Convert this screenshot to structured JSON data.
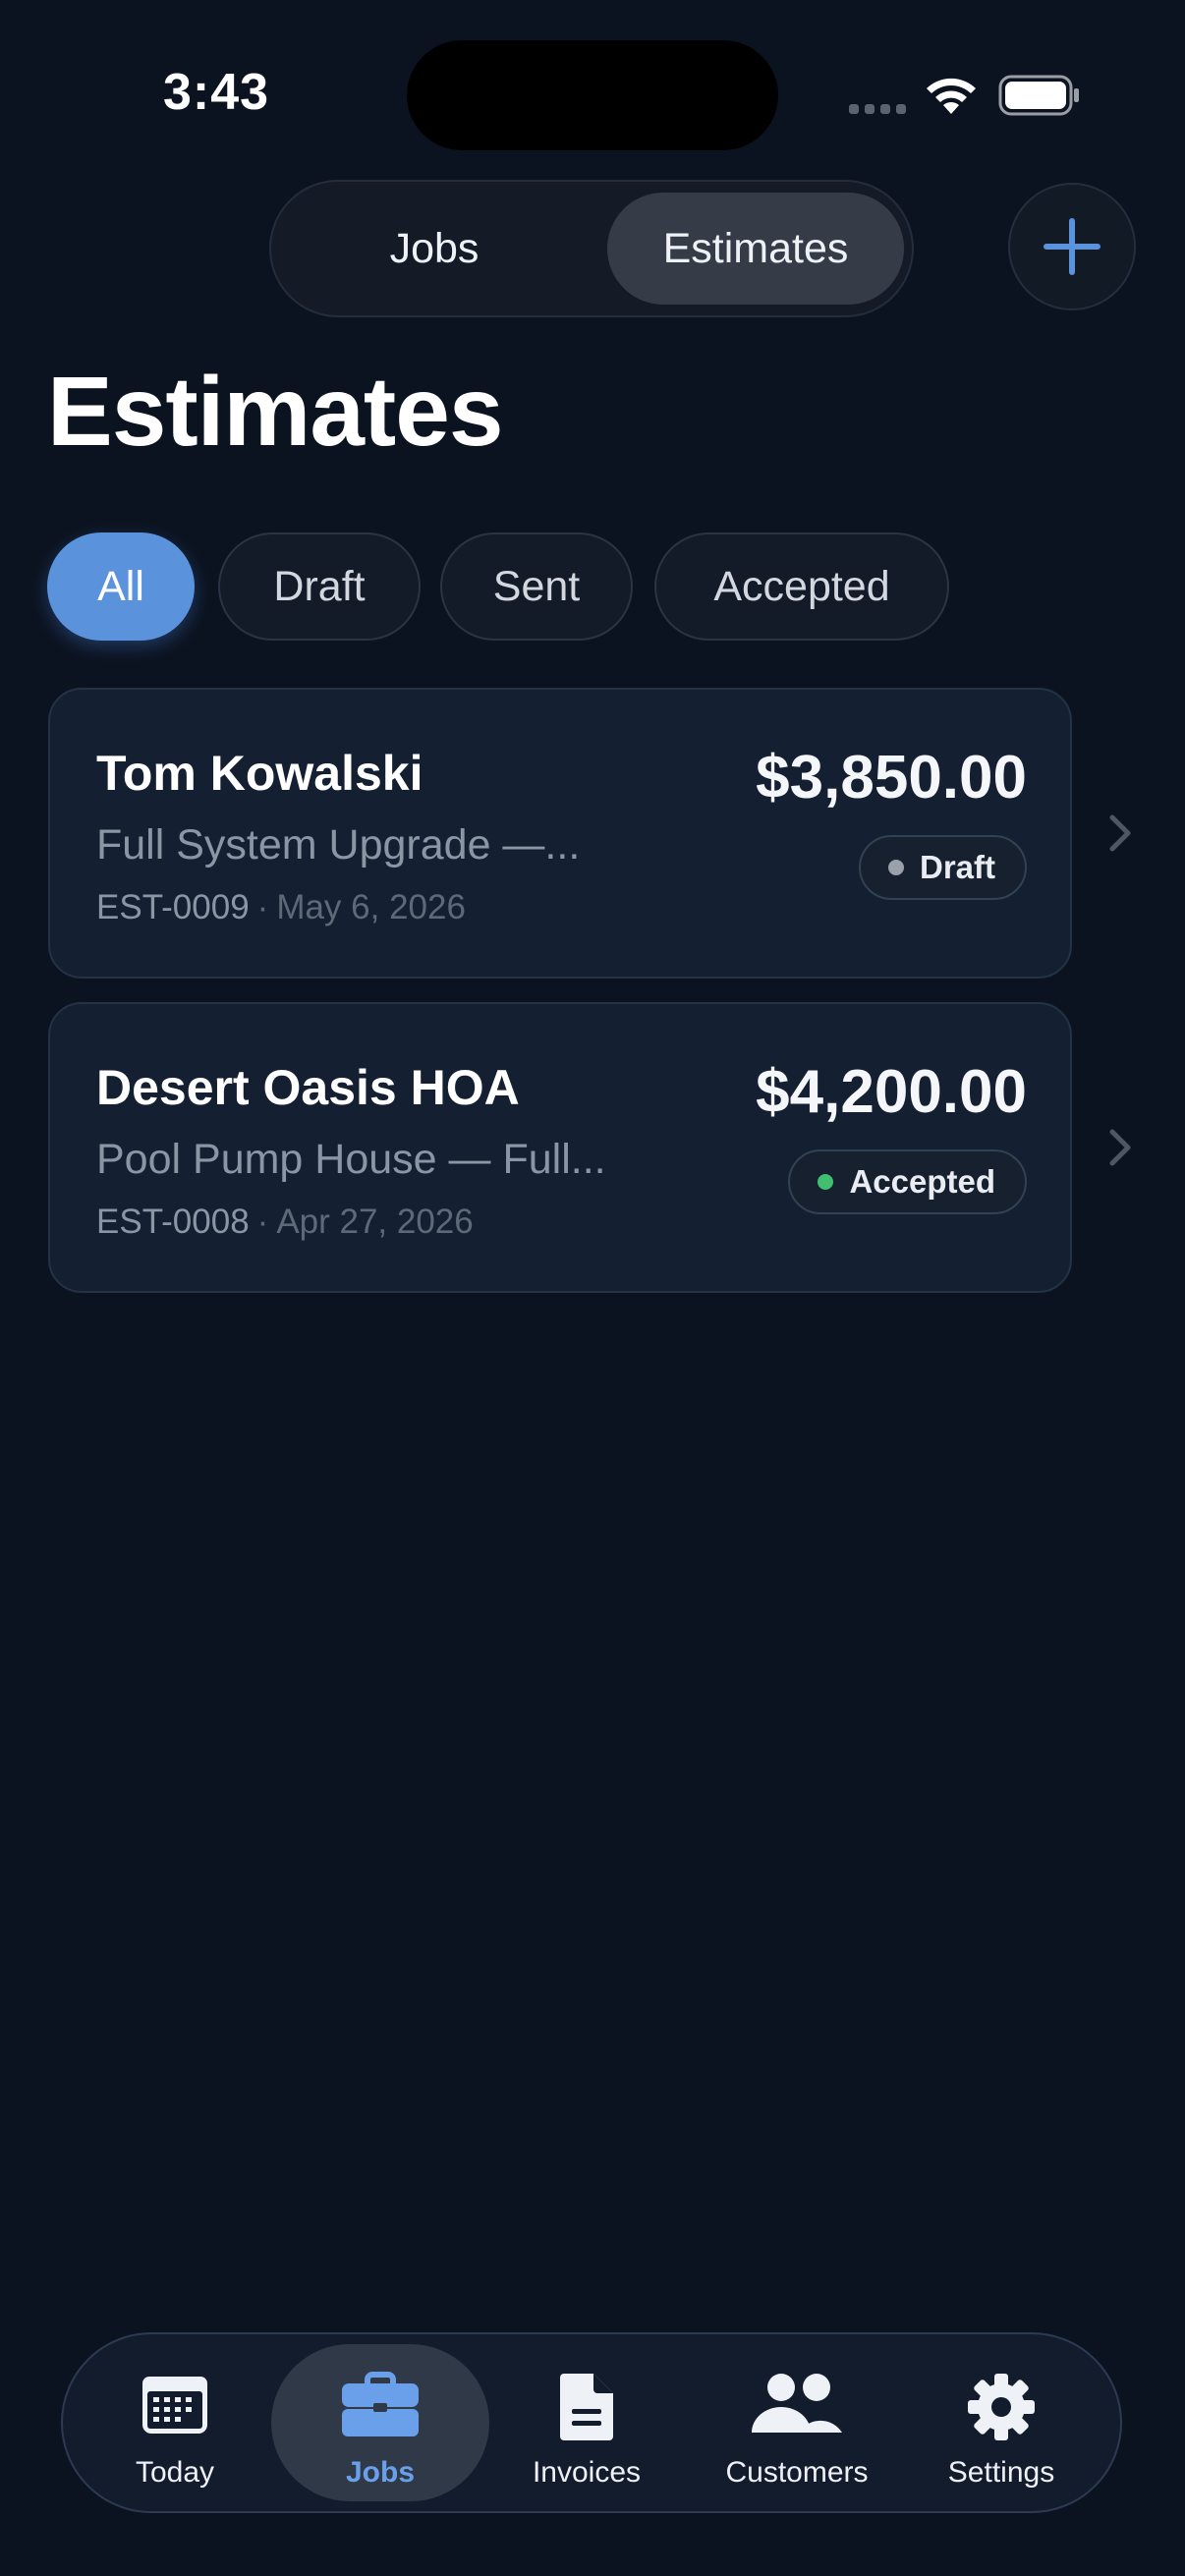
{
  "status_bar": {
    "time": "3:43"
  },
  "header": {
    "segments": [
      {
        "label": "Jobs",
        "selected": false
      },
      {
        "label": "Estimates",
        "selected": true
      }
    ],
    "add_icon": "plus-icon",
    "title": "Estimates"
  },
  "filters": [
    {
      "label": "All",
      "selected": true
    },
    {
      "label": "Draft",
      "selected": false
    },
    {
      "label": "Sent",
      "selected": false
    },
    {
      "label": "Accepted",
      "selected": false
    }
  ],
  "estimates": [
    {
      "customer": "Tom Kowalski",
      "description": "Full System Upgrade —...",
      "number": "EST-0009",
      "separator": "·",
      "date": "May 6, 2026",
      "amount": "$3,850.00",
      "status": "Draft",
      "status_color": "#9aa1ab"
    },
    {
      "customer": "Desert Oasis HOA",
      "description": "Pool Pump House — Full...",
      "number": "EST-0008",
      "separator": "·",
      "date": "Apr 27, 2026",
      "amount": "$4,200.00",
      "status": "Accepted",
      "status_color": "#3fbf6f"
    }
  ],
  "tab_bar": [
    {
      "label": "Today",
      "icon": "calendar-icon",
      "active": false
    },
    {
      "label": "Jobs",
      "icon": "briefcase-icon",
      "active": true
    },
    {
      "label": "Invoices",
      "icon": "document-icon",
      "active": false
    },
    {
      "label": "Customers",
      "icon": "people-icon",
      "active": false
    },
    {
      "label": "Settings",
      "icon": "gear-icon",
      "active": false
    }
  ],
  "colors": {
    "background": "#0c1320",
    "accent": "#5b92dc",
    "active_tab": "#6aa0ea",
    "card": "#142031"
  }
}
